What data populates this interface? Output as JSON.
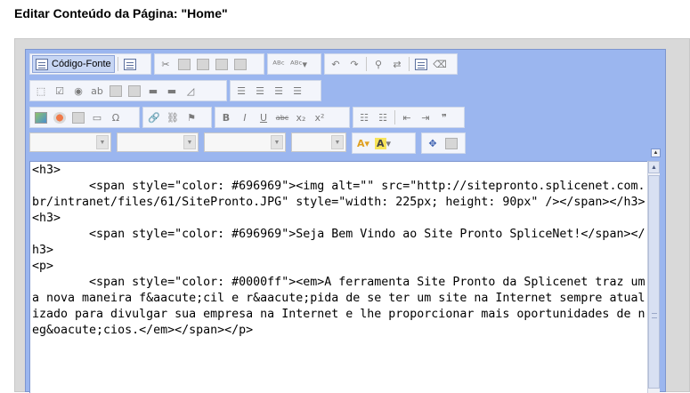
{
  "page": {
    "title": "Editar Conteúdo da Página: \"Home\""
  },
  "toolbar": {
    "source_label": "Código-Fonte",
    "row1_icons": [
      "preview-icon",
      "cut-icon",
      "copy-icon",
      "paste-icon",
      "paste-text-icon",
      "paste-word-icon",
      "spellcheck-icon",
      "spellcheck-dropdown-icon",
      "undo-icon",
      "redo-icon",
      "find-icon",
      "replace-icon",
      "select-all-icon",
      "remove-format-icon"
    ],
    "row2_icons": [
      "form-icon",
      "checkbox-icon",
      "radio-icon",
      "textfield-icon",
      "textarea-icon",
      "select-icon",
      "button-icon",
      "image-button-icon",
      "hidden-field-icon",
      "align-left-icon",
      "align-center-icon",
      "align-right-icon",
      "justify-icon"
    ],
    "row3_icons": [
      "image-icon",
      "flash-icon",
      "table-icon",
      "horizontal-rule-icon",
      "special-char-icon",
      "link-icon",
      "unlink-icon",
      "anchor-icon",
      "bold-icon",
      "italic-icon",
      "underline-icon",
      "strikethrough-icon",
      "subscript-icon",
      "superscript-icon",
      "numbered-list-icon",
      "bulleted-list-icon",
      "outdent-icon",
      "indent-icon",
      "blockquote-icon"
    ],
    "row4_combos": [
      "style-combo",
      "format-combo",
      "font-combo",
      "size-combo"
    ],
    "row4_icons": [
      "text-color-icon",
      "background-color-icon",
      "maximize-icon",
      "show-blocks-icon"
    ]
  },
  "editor": {
    "source_code": "<h3>\n\t<span style=\"color: #696969\"><img alt=\"\" src=\"http://sitepronto.splicenet.com.br/intranet/files/61/SitePronto.JPG\" style=\"width: 225px; height: 90px\" /></span></h3>\n<h3>\n\t<span style=\"color: #696969\">Seja Bem Vindo ao Site Pronto SpliceNet!</span></h3>\n<p>\n\t<span style=\"color: #0000ff\"><em>A ferramenta Site Pronto da Splicenet traz uma nova maneira f&aacute;cil e r&aacute;pida de se ter um site na Internet sempre atualizado para divulgar sua empresa na Internet e lhe proporcionar mais oportunidades de neg&oacute;cios.</em></span></p>"
  },
  "colors": {
    "toolbar_bg": "#9bb6ef",
    "button_bg": "#f3f5fb",
    "source_active": "#c7d6f4"
  }
}
